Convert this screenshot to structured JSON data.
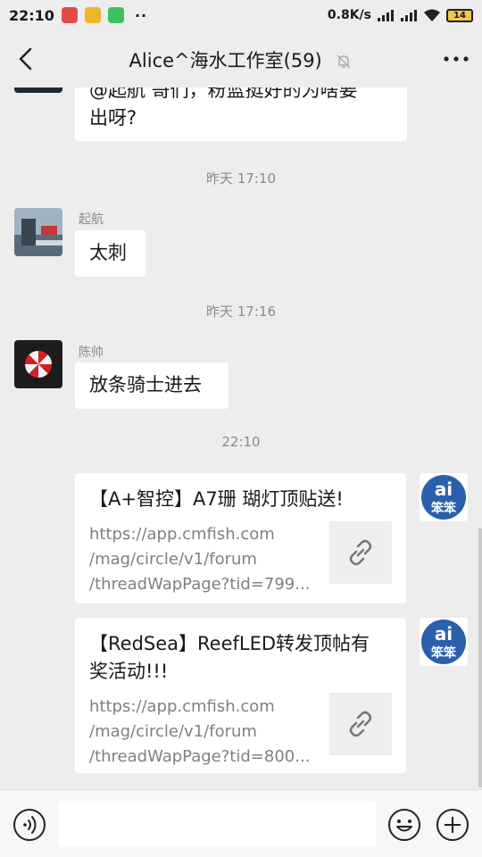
{
  "status_bar": {
    "time": "22:10",
    "dots": "··",
    "network_speed": "0.8K/s",
    "battery": "14"
  },
  "header": {
    "title": "Alice^海水工作室(59)"
  },
  "messages": {
    "m1": {
      "text_line1": "@起航  哥们，粉蓝挺好的为啥要",
      "text_line2": "出呀?"
    },
    "ts1": "昨天 17:10",
    "m2": {
      "sender": "起航",
      "text": "太刺"
    },
    "ts2": "昨天 17:16",
    "m3": {
      "sender": "陈帅",
      "text": "放条骑士进去"
    },
    "ts3": "22:10",
    "m4": {
      "title": "【A+智控】A7珊 瑚灯顶贴送!",
      "url_line1": "https://app.cmfish.com",
      "url_line2": "/mag/circle/v1/forum",
      "url_line3": "/threadWapPage?tid=799..."
    },
    "m5": {
      "title_line1": "【RedSea】ReefLED转发顶帖有",
      "title_line2": "奖活动!!!",
      "url_line1": "https://app.cmfish.com",
      "url_line2": "/mag/circle/v1/forum",
      "url_line3": "/threadWapPage?tid=800..."
    },
    "self_avatar_text": "ai",
    "self_avatar_text2": "笨笨"
  },
  "input": {
    "placeholder": ""
  },
  "colors": {
    "background": "#ededed",
    "bubble": "#ffffff",
    "self_avatar_blue": "#2a5fae"
  }
}
